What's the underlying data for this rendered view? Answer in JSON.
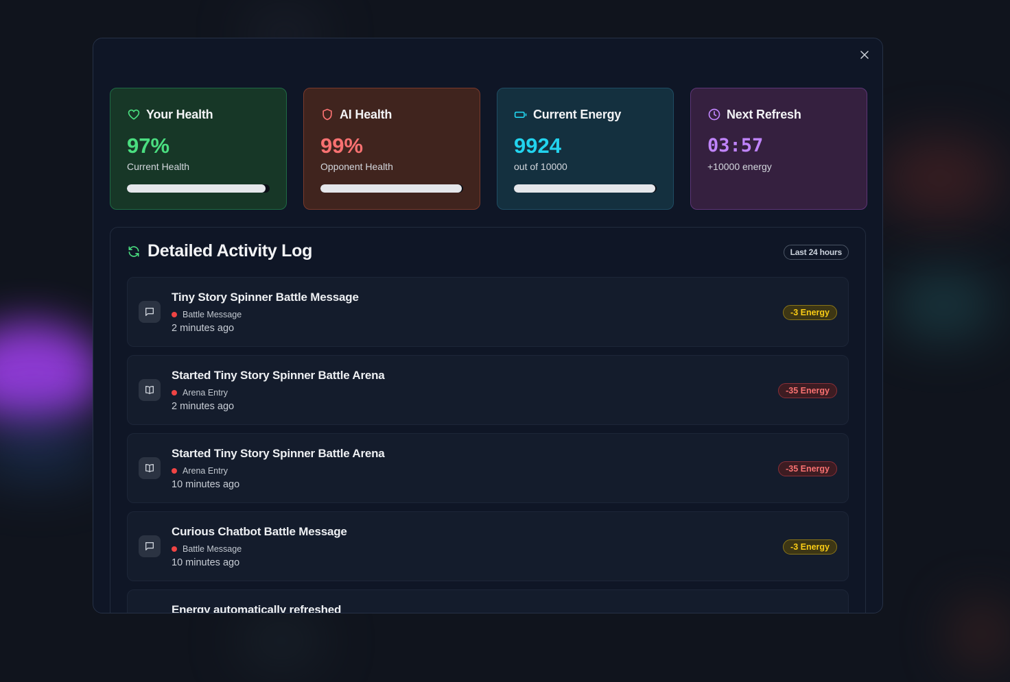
{
  "close": {
    "icon": "close-icon"
  },
  "stats": [
    {
      "title": "Your Health",
      "icon": "heart-icon",
      "value": "97%",
      "subtitle": "Current Health",
      "progress": 0.97,
      "color": "#4ade80"
    },
    {
      "title": "AI Health",
      "icon": "shield-icon",
      "value": "99%",
      "subtitle": "Opponent Health",
      "progress": 0.99,
      "color": "#f87171"
    },
    {
      "title": "Current Energy",
      "icon": "battery-icon",
      "value": "9924",
      "subtitle": "out of 10000",
      "progress": 0.9924,
      "color": "#22d3ee"
    },
    {
      "title": "Next Refresh",
      "icon": "clock-icon",
      "value": "03:57",
      "subtitle": "+10000 energy",
      "color": "#c084fc"
    }
  ],
  "activity": {
    "title": "Detailed Activity Log",
    "range_label": "Last 24 hours",
    "entries": [
      {
        "title": "Tiny Story Spinner Battle Message",
        "category": "Battle Message",
        "time": "2 minutes ago",
        "badge": "-3 Energy",
        "icon": "message-icon"
      },
      {
        "title": "Started Tiny Story Spinner Battle Arena",
        "category": "Arena Entry",
        "time": "2 minutes ago",
        "badge": "-35 Energy",
        "icon": "book-icon"
      },
      {
        "title": "Started Tiny Story Spinner Battle Arena",
        "category": "Arena Entry",
        "time": "10 minutes ago",
        "badge": "-35 Energy",
        "icon": "book-icon"
      },
      {
        "title": "Curious Chatbot Battle Message",
        "category": "Battle Message",
        "time": "10 minutes ago",
        "badge": "-3 Energy",
        "icon": "message-icon"
      },
      {
        "title": "Energy automatically refreshed"
      }
    ]
  }
}
